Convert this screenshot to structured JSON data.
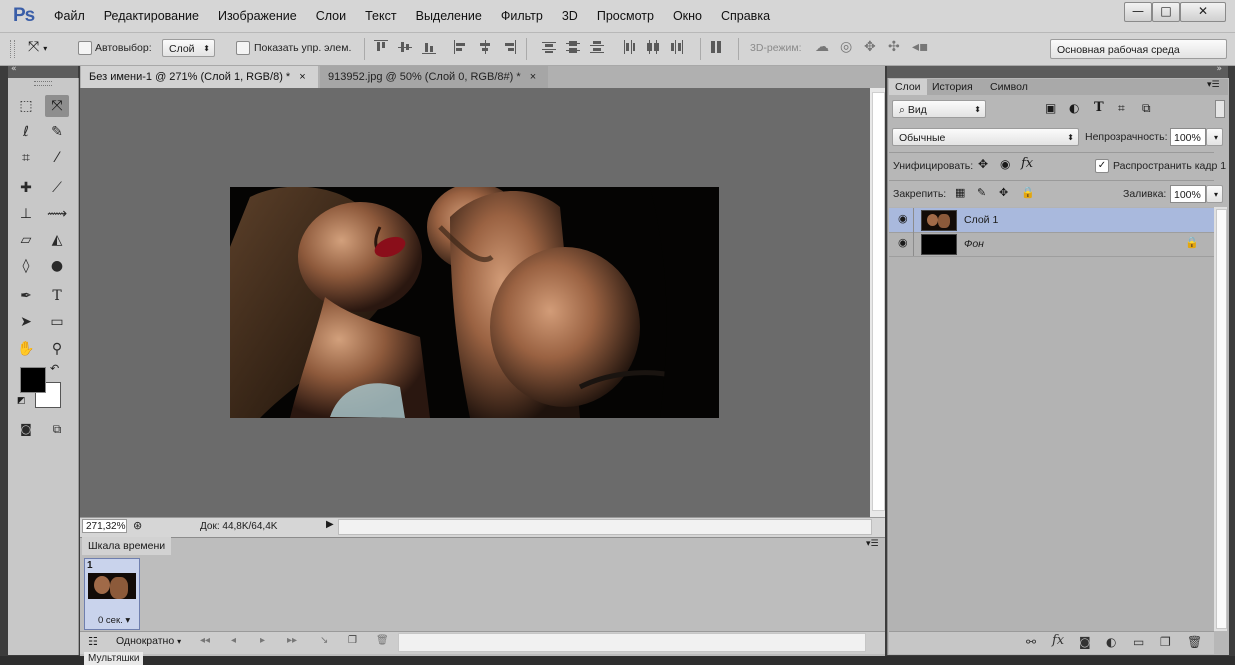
{
  "app": {
    "logo": "Ps"
  },
  "menu": [
    "Файл",
    "Редактирование",
    "Изображение",
    "Слои",
    "Текст",
    "Выделение",
    "Фильтр",
    "3D",
    "Просмотр",
    "Окно",
    "Справка"
  ],
  "window_controls": {
    "minimize": "—",
    "maximize": "□",
    "close": "✕"
  },
  "options_bar": {
    "autoselect_label": "Автовыбор:",
    "autoselect_value": "Слой",
    "show_transform_label": "Показать упр. элем.",
    "mode_3d_label": "3D-режим:",
    "workspace": "Основная рабочая среда"
  },
  "tabs": [
    {
      "label": "Без имени-1 @ 271% (Слой 1, RGB/8) *",
      "close": "×"
    },
    {
      "label": "913952.jpg @ 50% (Слой 0, RGB/8#) *",
      "close": "×"
    }
  ],
  "status": {
    "zoom": "271,32%",
    "doc": "Док: 44,8K/64,4K"
  },
  "timeline": {
    "title": "Шкала времени",
    "frame_number": "1",
    "frame_delay": "0 сек.",
    "loop": "Однократно"
  },
  "panels": {
    "tabs": [
      "Слои",
      "История",
      "Символ"
    ],
    "filter_kind": "Вид",
    "blend_mode": "Обычные",
    "opacity_label": "Непрозрачность:",
    "opacity": "100%",
    "unify_label": "Унифицировать:",
    "propagate_label": "Распространить кадр 1",
    "lock_label": "Закрепить:",
    "fill_label": "Заливка:",
    "fill": "100%"
  },
  "layers": [
    {
      "name": "Слой 1",
      "selected": true
    },
    {
      "name": "Фон",
      "selected": false,
      "locked": true
    }
  ],
  "taskbar": {
    "label": "Мультяшки"
  },
  "colors": {
    "accent": "#3a5ea8",
    "selection": "#a9b9dd",
    "canvas_bg": "#6b6b6b"
  }
}
